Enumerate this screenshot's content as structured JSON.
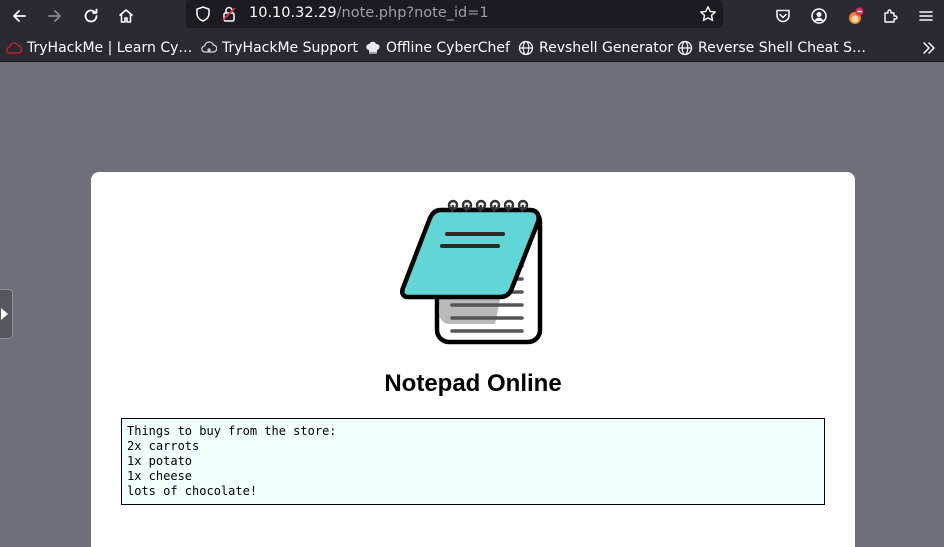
{
  "browser": {
    "url_host": "10.10.32.29",
    "url_path": "/note.php?note_id=1"
  },
  "bookmarks": [
    {
      "label": "TryHackMe | Learn Cy…",
      "icon": "tryhackme-cloud-icon"
    },
    {
      "label": "TryHackMe Support",
      "icon": "support-cloud-icon"
    },
    {
      "label": "Offline CyberChef",
      "icon": "chef-hat-icon"
    },
    {
      "label": "Revshell Generator",
      "icon": "globe-icon"
    },
    {
      "label": "Reverse Shell Cheat S…",
      "icon": "globe-icon"
    }
  ],
  "page": {
    "title": "Notepad Online",
    "note": "Things to buy from the store:\n2x carrots\n1x potato\n1x cheese\nlots of chocolate!"
  },
  "colors": {
    "toolbar_bg": "#2b2a33",
    "page_bg": "#6f6f7b",
    "note_bg": "#f0ffff",
    "notepad_teal": "#62d6d6"
  }
}
